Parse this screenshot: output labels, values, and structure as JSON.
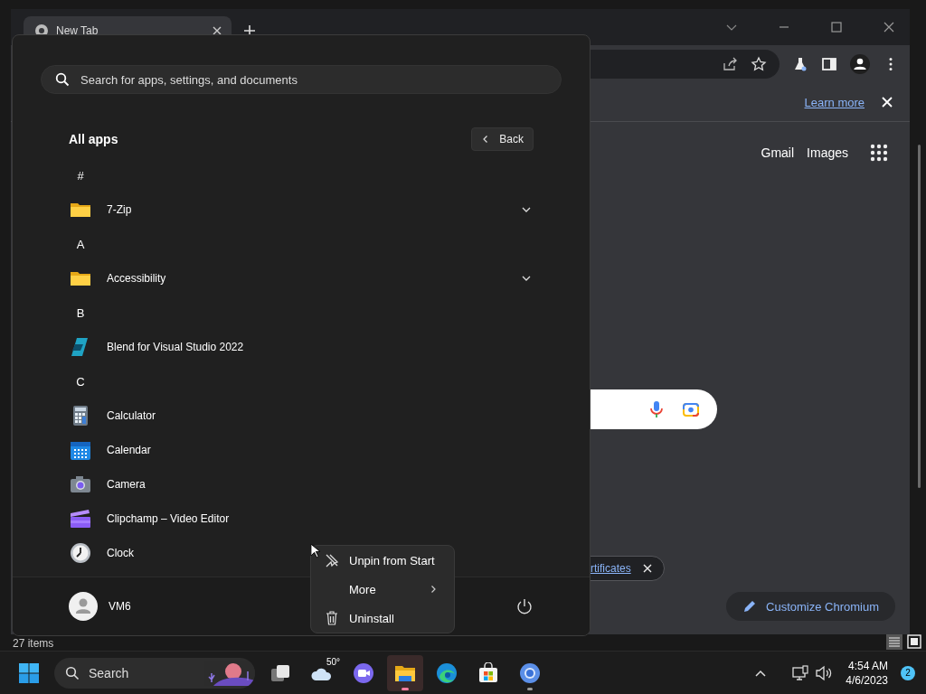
{
  "explorer_window": {
    "status_text": "27 items"
  },
  "browser": {
    "tab": {
      "title": "New Tab",
      "selected": true
    },
    "infobar": {
      "link": "Learn more"
    },
    "header_links": [
      "Gmail",
      "Images"
    ],
    "chip": {
      "link": "rtificates"
    },
    "customize_button": "Customize Chromium"
  },
  "start_menu": {
    "search": {
      "placeholder": "Search for apps, settings, and documents"
    },
    "heading": "All apps",
    "back_button": "Back",
    "user": "VM6",
    "apps": [
      {
        "kind": "letter",
        "label": "#"
      },
      {
        "kind": "folder",
        "label": "7-Zip",
        "expandable": true
      },
      {
        "kind": "letter",
        "label": "A"
      },
      {
        "kind": "folder",
        "label": "Accessibility",
        "expandable": true
      },
      {
        "kind": "letter",
        "label": "B"
      },
      {
        "kind": "blend",
        "label": "Blend for Visual Studio 2022",
        "expandable": false
      },
      {
        "kind": "letter",
        "label": "C"
      },
      {
        "kind": "calculator",
        "label": "Calculator",
        "expandable": false
      },
      {
        "kind": "calendar",
        "label": "Calendar",
        "expandable": false
      },
      {
        "kind": "camera",
        "label": "Camera",
        "expandable": false
      },
      {
        "kind": "clipchamp",
        "label": "Clipchamp – Video Editor",
        "expandable": false
      },
      {
        "kind": "clock",
        "label": "Clock",
        "expandable": false
      }
    ]
  },
  "context_menu": {
    "items": [
      {
        "kind": "unpin",
        "label": "Unpin from Start"
      },
      {
        "kind": "submenu",
        "label": "More"
      },
      {
        "kind": "uninstall",
        "label": "Uninstall"
      }
    ]
  },
  "taskbar": {
    "search": "Search",
    "weather": "50°",
    "apps": [
      {
        "kind": "taskview",
        "running": false,
        "selected": false
      },
      {
        "kind": "weather",
        "running": false,
        "selected": false
      },
      {
        "kind": "meet",
        "running": false,
        "selected": false
      },
      {
        "kind": "explorer",
        "running": true,
        "selected": true
      },
      {
        "kind": "edge",
        "running": false,
        "selected": false
      },
      {
        "kind": "store",
        "running": false,
        "selected": false
      },
      {
        "kind": "chrome",
        "running": true,
        "selected": false
      }
    ],
    "time": "4:54 AM",
    "date": "4/6/2023",
    "notifications": "2"
  }
}
